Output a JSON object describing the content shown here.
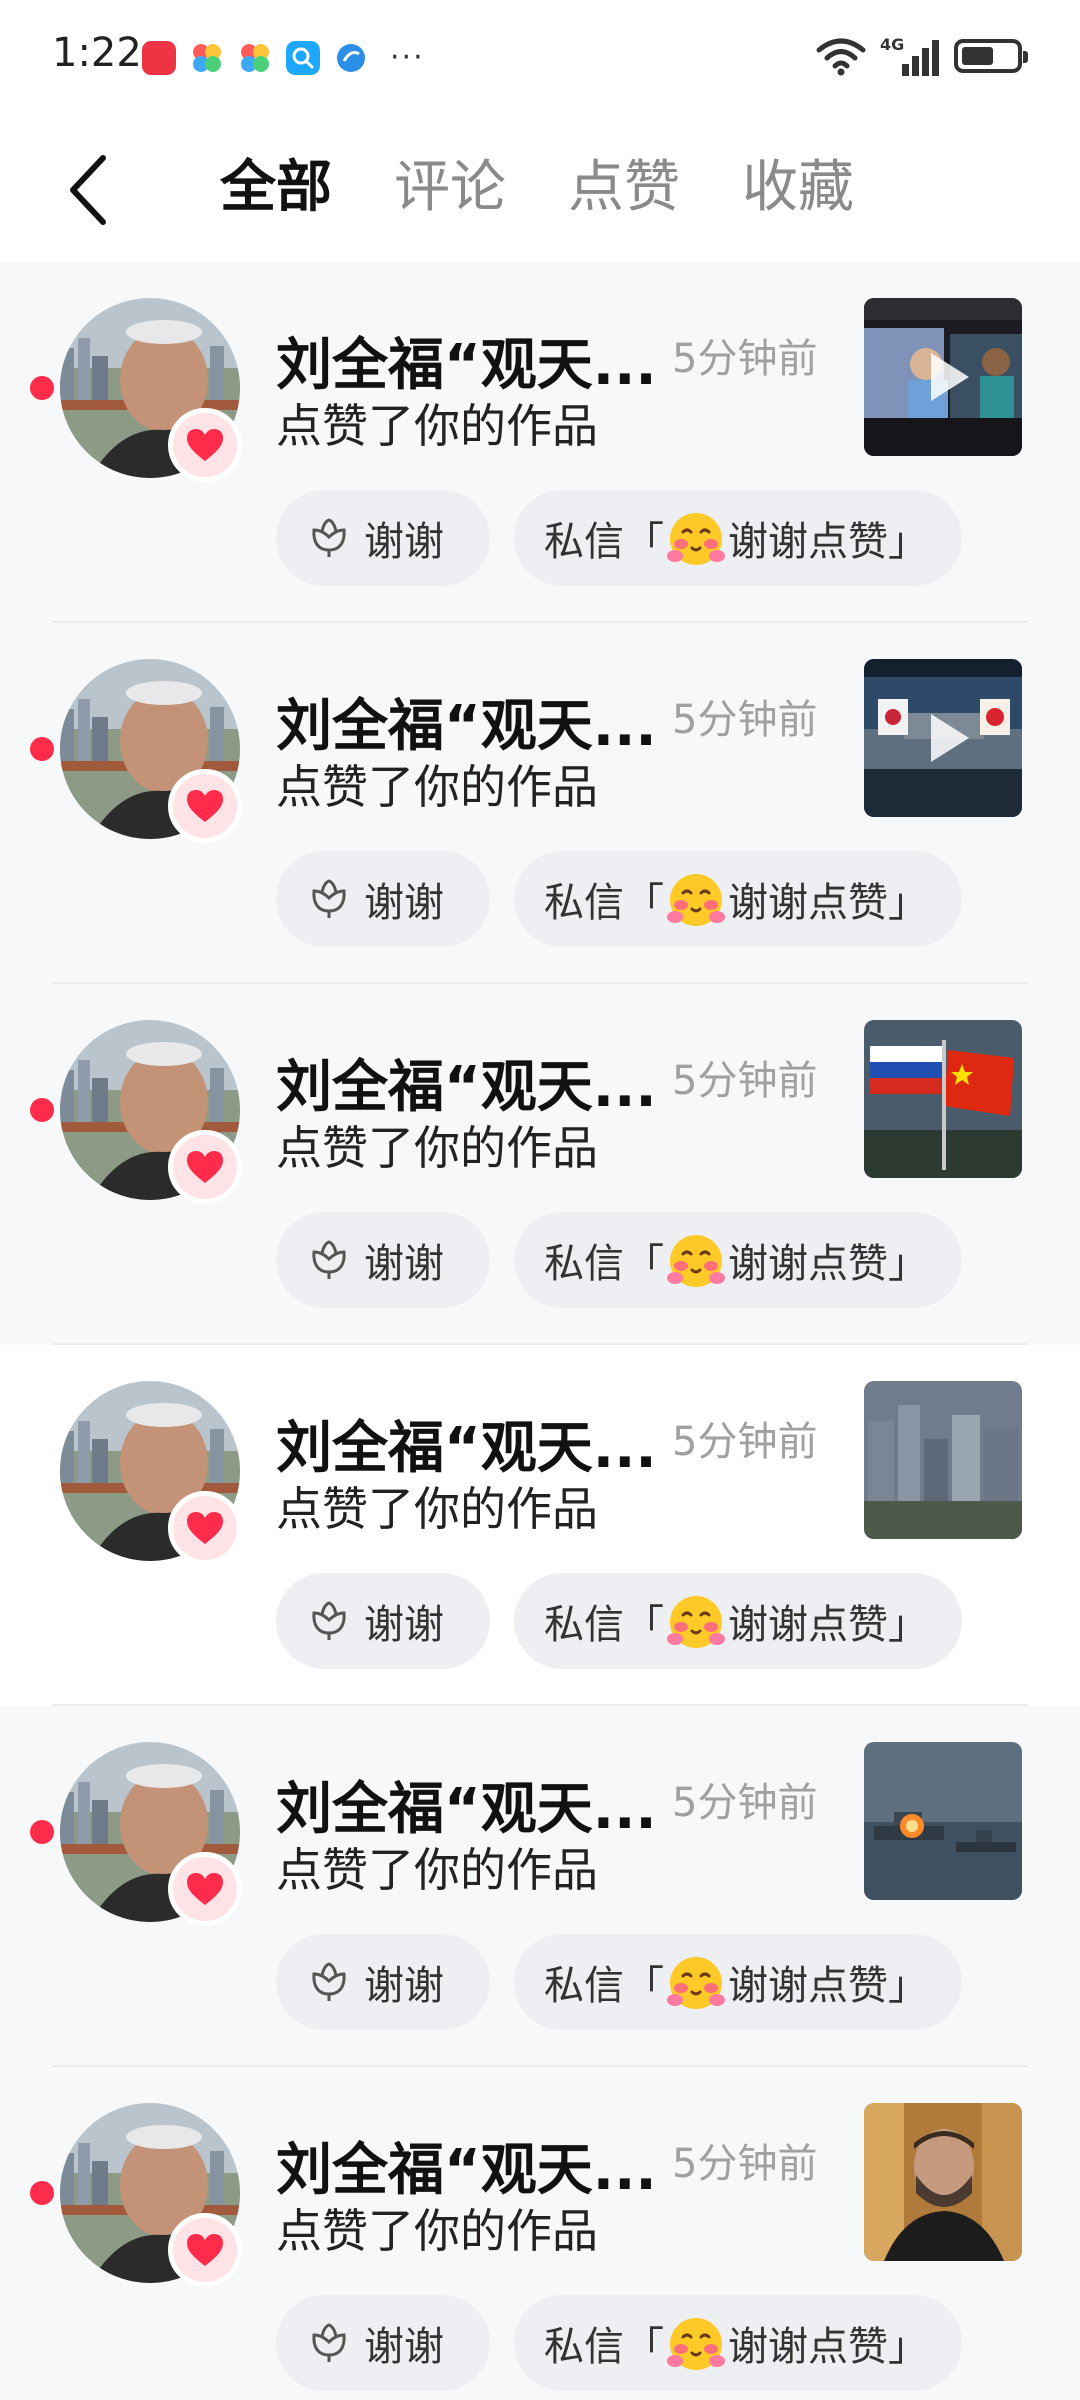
{
  "status_bar": {
    "time": "1:22",
    "network": "4G",
    "battery_level": 0.6,
    "notification_icons": [
      "app-store-icon",
      "photos-icon",
      "photos-icon",
      "search-app-icon",
      "browser-icon"
    ],
    "more": "···"
  },
  "header": {
    "back_icon": "back-arrow-icon",
    "tabs": [
      {
        "label": "全部",
        "active": true
      },
      {
        "label": "评论",
        "active": false
      },
      {
        "label": "点赞",
        "active": false
      },
      {
        "label": "收藏",
        "active": false
      }
    ]
  },
  "notifications": [
    {
      "name": "刘全福“观天...",
      "time": "5分钟前",
      "action": "点赞了你的作品",
      "unread": true,
      "thumbnail": "news-video-thumbnail",
      "has_play": true,
      "thanks_label": "谢谢",
      "dm_prefix": "私信「",
      "dm_text": "谢谢点赞」"
    },
    {
      "name": "刘全福“观天...",
      "time": "5分钟前",
      "action": "点赞了你的作品",
      "unread": true,
      "thumbnail": "naval-flags-thumbnail",
      "has_play": true,
      "thanks_label": "谢谢",
      "dm_prefix": "私信「",
      "dm_text": "谢谢点赞」"
    },
    {
      "name": "刘全福“观天...",
      "time": "5分钟前",
      "action": "点赞了你的作品",
      "unread": true,
      "thumbnail": "flags-thumbnail",
      "has_play": false,
      "thanks_label": "谢谢",
      "dm_prefix": "私信「",
      "dm_text": "谢谢点赞」"
    },
    {
      "name": "刘全福“观天...",
      "time": "5分钟前",
      "action": "点赞了你的作品",
      "unread": false,
      "thumbnail": "city-thumbnail",
      "has_play": false,
      "thanks_label": "谢谢",
      "dm_prefix": "私信「",
      "dm_text": "谢谢点赞」"
    },
    {
      "name": "刘全福“观天...",
      "time": "5分钟前",
      "action": "点赞了你的作品",
      "unread": true,
      "thumbnail": "warship-thumbnail",
      "has_play": false,
      "thanks_label": "谢谢",
      "dm_prefix": "私信「",
      "dm_text": "谢谢点赞」"
    },
    {
      "name": "刘全福“观天...",
      "time": "5分钟前",
      "action": "点赞了你的作品",
      "unread": true,
      "thumbnail": "portrait-thumbnail",
      "has_play": false,
      "thanks_label": "谢谢",
      "dm_prefix": "私信「",
      "dm_text": "谢谢点赞」"
    }
  ],
  "colors": {
    "accent_red": "#ff2b4b",
    "unread_background": "#f7f8fa",
    "button_background": "#eeeff2",
    "muted_text": "#a0a0a0"
  }
}
